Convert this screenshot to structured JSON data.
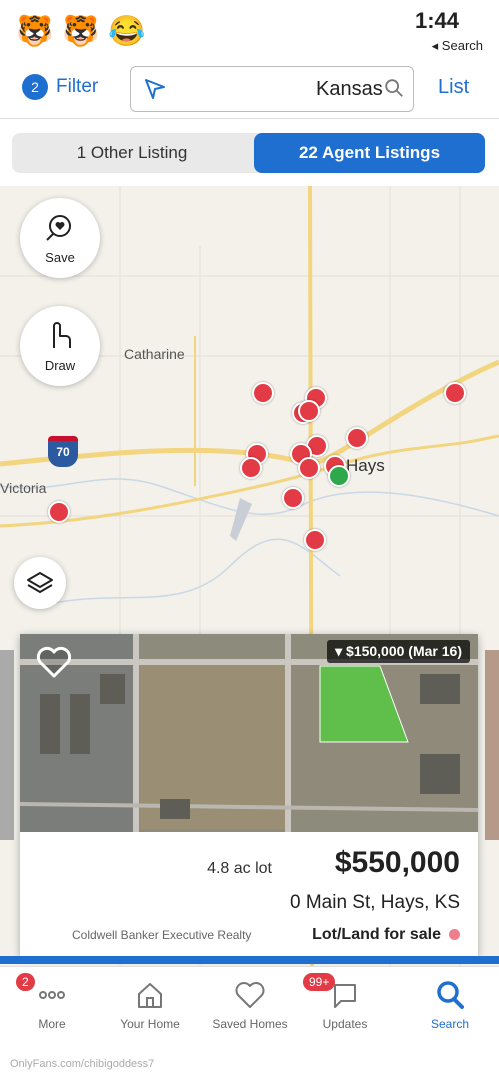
{
  "status_bar": {
    "time": "1:44",
    "back_label": "◂ Search",
    "emojis": [
      "😂",
      "🐯",
      "🐯"
    ]
  },
  "header": {
    "list_label": "List",
    "search_value": "Kansas",
    "filter_label": "Filter",
    "filter_count": "2"
  },
  "segment": {
    "selected": "22 Agent Listings",
    "other": "1 Other Listing"
  },
  "map": {
    "save_label": "Save",
    "draw_label": "Draw",
    "places": {
      "catharine": "Catharine",
      "victoria": "Victoria",
      "hays": "Hays",
      "interstate": "70"
    }
  },
  "listing": {
    "price_history": "▾ $150,000 (Mar 16)",
    "price": "$550,000",
    "lot_size": "4.8 ac lot",
    "address": "0 Main St, Hays, KS",
    "status": "Lot/Land for sale",
    "broker": "Coldwell Banker Executive Realty"
  },
  "tabs": [
    {
      "label": "Search",
      "icon": "search-icon"
    },
    {
      "label": "Updates",
      "icon": "chat-icon",
      "badge": "99+"
    },
    {
      "label": "Saved Homes",
      "icon": "heart-icon"
    },
    {
      "label": "Your Home",
      "icon": "house-icon"
    },
    {
      "label": "More",
      "icon": "more-icon",
      "badge": "2"
    }
  ],
  "watermark": "OnlyFans.com/chibigoddess7",
  "colors": {
    "accent": "#1f6fd1",
    "marker": "#e23b45",
    "marker_selected": "#2ea84a"
  }
}
